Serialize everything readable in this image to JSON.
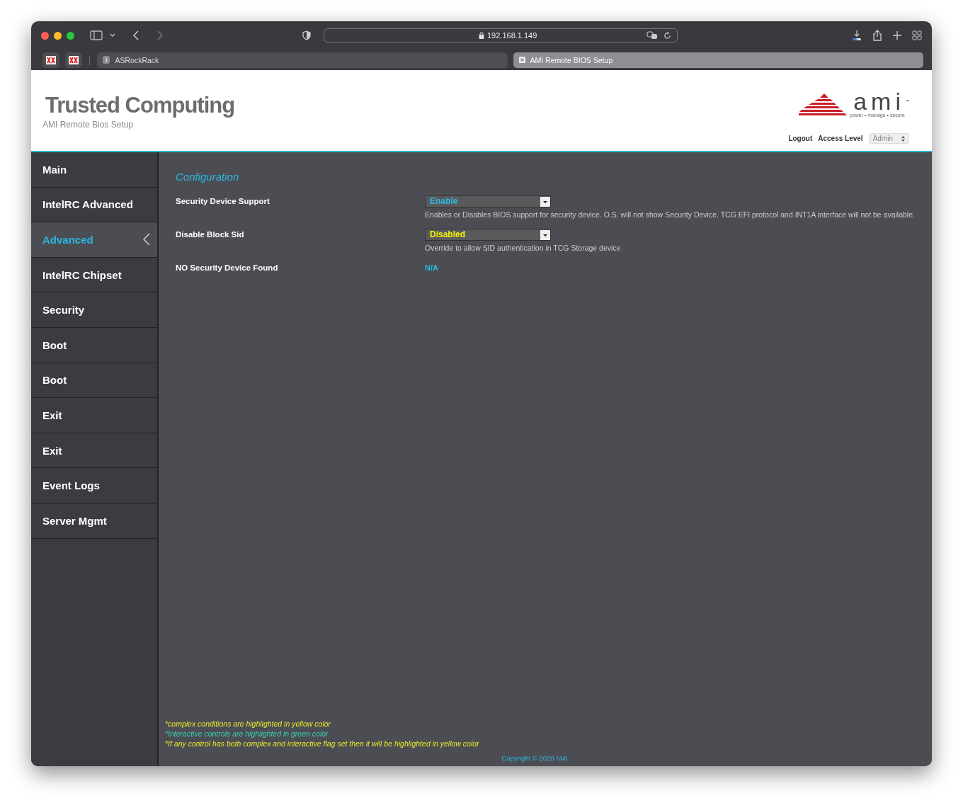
{
  "browser": {
    "url": "192.168.1.149",
    "tabs": [
      {
        "label": "ASRockRack",
        "badge": "1",
        "selected": false
      },
      {
        "label": "AMI Remote BIOS Setup",
        "selected": true
      }
    ]
  },
  "header": {
    "title": "Trusted Computing",
    "subtitle": "AMI Remote Bios Setup",
    "logo": {
      "word": "ami",
      "mark": "™",
      "tagline": "power • manage • secure"
    },
    "logout": "Logout",
    "access_label": "Access Level",
    "access_value": "Admin"
  },
  "sidebar": {
    "items": [
      {
        "label": "Main",
        "selected": false
      },
      {
        "label": "IntelRC Advanced",
        "selected": false
      },
      {
        "label": "Advanced",
        "selected": true
      },
      {
        "label": "IntelRC Chipset",
        "selected": false
      },
      {
        "label": "Security",
        "selected": false
      },
      {
        "label": "Boot",
        "selected": false
      },
      {
        "label": "Boot",
        "selected": false
      },
      {
        "label": "Exit",
        "selected": false
      },
      {
        "label": "Exit",
        "selected": false
      },
      {
        "label": "Event Logs",
        "selected": false
      },
      {
        "label": "Server Mgmt",
        "selected": false
      }
    ]
  },
  "section_title": "Configuration",
  "settings": [
    {
      "kind": "select",
      "label": "Security Device Support",
      "value": "Enable",
      "color": "#2ab8e0",
      "help": "Enables or Disables BIOS support for security device. O.S. will not show Security Device. TCG EFI protocol and INT1A interface will not be available."
    },
    {
      "kind": "select",
      "label": "Disable Block Sid",
      "value": "Disabled",
      "color": "#f5f500",
      "help": "Override to allow SID authentication in TCG Storage device"
    },
    {
      "kind": "text",
      "label": "NO Security Device Found",
      "value": "N/A"
    }
  ],
  "notes": [
    {
      "text": "*complex conditions are highlighted in yellow color",
      "color": "#e8e82a"
    },
    {
      "text": "*Interactive controls are highlighted in green color",
      "color": "#37d0b0"
    },
    {
      "text": "*If any control has both complex and interactive flag set then it will be highlighted in yellow color",
      "color": "#e8e82a"
    }
  ],
  "copyright": "Copyright © 2020 AMI"
}
